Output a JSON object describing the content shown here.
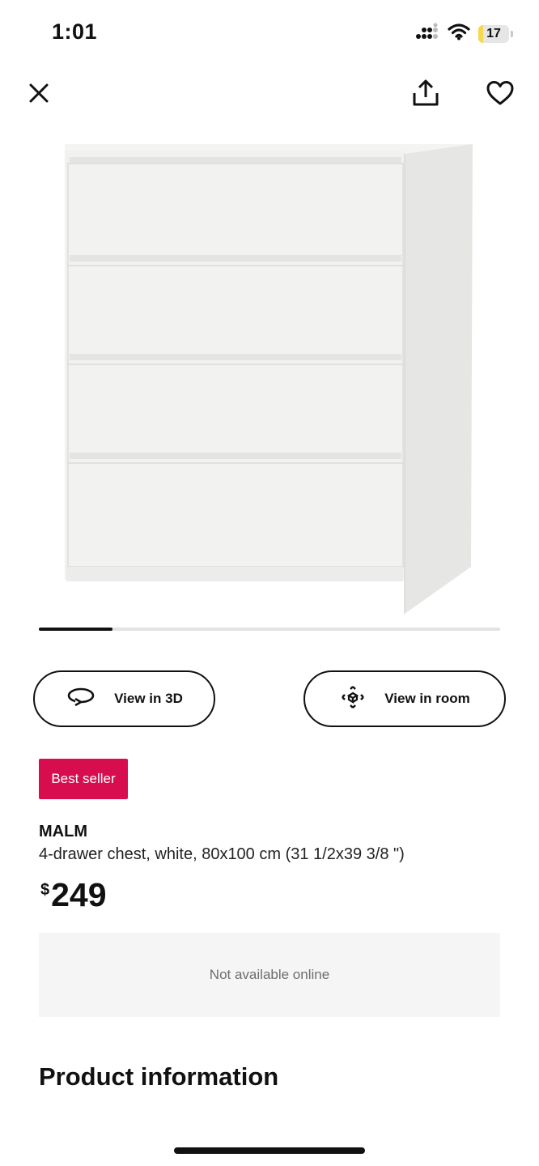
{
  "status_bar": {
    "time": "1:01",
    "battery_level": "17",
    "battery_fraction": 0.17,
    "icons": [
      "cellular-signal-icon",
      "wifi-icon",
      "battery-icon"
    ]
  },
  "top_bar": {
    "icons": [
      "close-icon",
      "share-icon",
      "favorite-heart-icon"
    ]
  },
  "product_image": {
    "icon": "malm-chest-image"
  },
  "carousel": {
    "progress": 0.16
  },
  "actions": {
    "view_3d_label": "View in 3D",
    "view_room_label": "View in room",
    "view_3d_icon": "rotate-3d-icon",
    "view_room_icon": "ar-view-icon"
  },
  "product": {
    "badge": "Best seller",
    "name": "MALM",
    "description": "4-drawer chest, white, 80x100 cm (31 1/2x39 3/8 \")",
    "price_currency": "$",
    "price_amount": "249"
  },
  "availability": {
    "text": "Not available online"
  },
  "sections": {
    "product_information": "Product information"
  },
  "colors": {
    "badge_bg": "#d70d50",
    "availability_bg": "#f5f5f5",
    "text": "#111111",
    "muted_text": "#6e6e6e"
  }
}
